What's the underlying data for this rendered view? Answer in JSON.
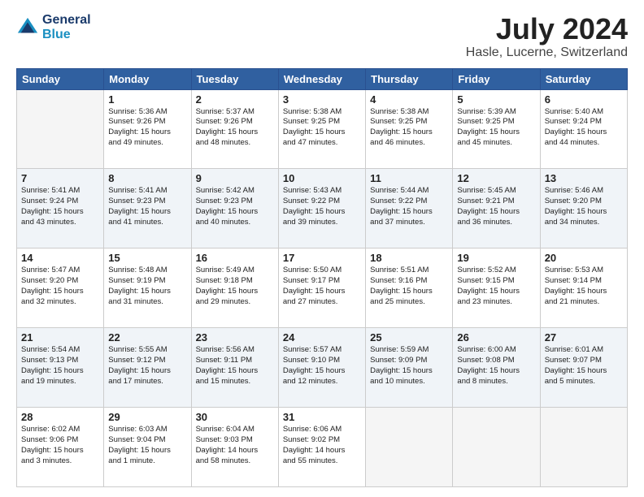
{
  "header": {
    "logo_line1": "General",
    "logo_line2": "Blue",
    "title": "July 2024",
    "subtitle": "Hasle, Lucerne, Switzerland"
  },
  "days_of_week": [
    "Sunday",
    "Monday",
    "Tuesday",
    "Wednesday",
    "Thursday",
    "Friday",
    "Saturday"
  ],
  "weeks": [
    {
      "shaded": false,
      "days": [
        {
          "number": "",
          "text": ""
        },
        {
          "number": "1",
          "text": "Sunrise: 5:36 AM\nSunset: 9:26 PM\nDaylight: 15 hours\nand 49 minutes."
        },
        {
          "number": "2",
          "text": "Sunrise: 5:37 AM\nSunset: 9:26 PM\nDaylight: 15 hours\nand 48 minutes."
        },
        {
          "number": "3",
          "text": "Sunrise: 5:38 AM\nSunset: 9:25 PM\nDaylight: 15 hours\nand 47 minutes."
        },
        {
          "number": "4",
          "text": "Sunrise: 5:38 AM\nSunset: 9:25 PM\nDaylight: 15 hours\nand 46 minutes."
        },
        {
          "number": "5",
          "text": "Sunrise: 5:39 AM\nSunset: 9:25 PM\nDaylight: 15 hours\nand 45 minutes."
        },
        {
          "number": "6",
          "text": "Sunrise: 5:40 AM\nSunset: 9:24 PM\nDaylight: 15 hours\nand 44 minutes."
        }
      ]
    },
    {
      "shaded": true,
      "days": [
        {
          "number": "7",
          "text": "Sunrise: 5:41 AM\nSunset: 9:24 PM\nDaylight: 15 hours\nand 43 minutes."
        },
        {
          "number": "8",
          "text": "Sunrise: 5:41 AM\nSunset: 9:23 PM\nDaylight: 15 hours\nand 41 minutes."
        },
        {
          "number": "9",
          "text": "Sunrise: 5:42 AM\nSunset: 9:23 PM\nDaylight: 15 hours\nand 40 minutes."
        },
        {
          "number": "10",
          "text": "Sunrise: 5:43 AM\nSunset: 9:22 PM\nDaylight: 15 hours\nand 39 minutes."
        },
        {
          "number": "11",
          "text": "Sunrise: 5:44 AM\nSunset: 9:22 PM\nDaylight: 15 hours\nand 37 minutes."
        },
        {
          "number": "12",
          "text": "Sunrise: 5:45 AM\nSunset: 9:21 PM\nDaylight: 15 hours\nand 36 minutes."
        },
        {
          "number": "13",
          "text": "Sunrise: 5:46 AM\nSunset: 9:20 PM\nDaylight: 15 hours\nand 34 minutes."
        }
      ]
    },
    {
      "shaded": false,
      "days": [
        {
          "number": "14",
          "text": "Sunrise: 5:47 AM\nSunset: 9:20 PM\nDaylight: 15 hours\nand 32 minutes."
        },
        {
          "number": "15",
          "text": "Sunrise: 5:48 AM\nSunset: 9:19 PM\nDaylight: 15 hours\nand 31 minutes."
        },
        {
          "number": "16",
          "text": "Sunrise: 5:49 AM\nSunset: 9:18 PM\nDaylight: 15 hours\nand 29 minutes."
        },
        {
          "number": "17",
          "text": "Sunrise: 5:50 AM\nSunset: 9:17 PM\nDaylight: 15 hours\nand 27 minutes."
        },
        {
          "number": "18",
          "text": "Sunrise: 5:51 AM\nSunset: 9:16 PM\nDaylight: 15 hours\nand 25 minutes."
        },
        {
          "number": "19",
          "text": "Sunrise: 5:52 AM\nSunset: 9:15 PM\nDaylight: 15 hours\nand 23 minutes."
        },
        {
          "number": "20",
          "text": "Sunrise: 5:53 AM\nSunset: 9:14 PM\nDaylight: 15 hours\nand 21 minutes."
        }
      ]
    },
    {
      "shaded": true,
      "days": [
        {
          "number": "21",
          "text": "Sunrise: 5:54 AM\nSunset: 9:13 PM\nDaylight: 15 hours\nand 19 minutes."
        },
        {
          "number": "22",
          "text": "Sunrise: 5:55 AM\nSunset: 9:12 PM\nDaylight: 15 hours\nand 17 minutes."
        },
        {
          "number": "23",
          "text": "Sunrise: 5:56 AM\nSunset: 9:11 PM\nDaylight: 15 hours\nand 15 minutes."
        },
        {
          "number": "24",
          "text": "Sunrise: 5:57 AM\nSunset: 9:10 PM\nDaylight: 15 hours\nand 12 minutes."
        },
        {
          "number": "25",
          "text": "Sunrise: 5:59 AM\nSunset: 9:09 PM\nDaylight: 15 hours\nand 10 minutes."
        },
        {
          "number": "26",
          "text": "Sunrise: 6:00 AM\nSunset: 9:08 PM\nDaylight: 15 hours\nand 8 minutes."
        },
        {
          "number": "27",
          "text": "Sunrise: 6:01 AM\nSunset: 9:07 PM\nDaylight: 15 hours\nand 5 minutes."
        }
      ]
    },
    {
      "shaded": false,
      "days": [
        {
          "number": "28",
          "text": "Sunrise: 6:02 AM\nSunset: 9:06 PM\nDaylight: 15 hours\nand 3 minutes."
        },
        {
          "number": "29",
          "text": "Sunrise: 6:03 AM\nSunset: 9:04 PM\nDaylight: 15 hours\nand 1 minute."
        },
        {
          "number": "30",
          "text": "Sunrise: 6:04 AM\nSunset: 9:03 PM\nDaylight: 14 hours\nand 58 minutes."
        },
        {
          "number": "31",
          "text": "Sunrise: 6:06 AM\nSunset: 9:02 PM\nDaylight: 14 hours\nand 55 minutes."
        },
        {
          "number": "",
          "text": ""
        },
        {
          "number": "",
          "text": ""
        },
        {
          "number": "",
          "text": ""
        }
      ]
    }
  ]
}
